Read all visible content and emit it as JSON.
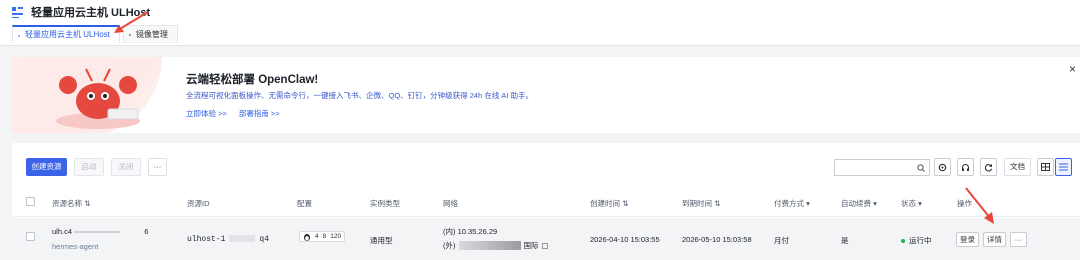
{
  "header": {
    "title": "轻量应用云主机 ULHost",
    "tabs": [
      {
        "label": "轻量应用云主机 ULHost",
        "active": true
      },
      {
        "label": "镜像管理",
        "active": false
      }
    ]
  },
  "banner": {
    "title": "云端轻松部署 OpenClaw!",
    "description": "全流程可视化面板操作、无需命令行，一键接入飞书、企微、QQ、钉钉，分钟级获得 24h 在线 AI 助手。",
    "link_try": "立即体验 >>",
    "link_guide": "部署指南 >>",
    "close": "×"
  },
  "toolbar": {
    "create": "创建资源",
    "start": "启动",
    "stop": "关闭",
    "more": "···",
    "search_placeholder": "",
    "docs": "文档"
  },
  "table": {
    "headers": {
      "name": "资源名称",
      "id": "资源ID",
      "config": "配置",
      "type": "实例类型",
      "network": "网络",
      "created": "创建时间",
      "expires": "到期时间",
      "billing": "付费方式",
      "renew": "自动续费",
      "status": "状态",
      "ops": "操作"
    },
    "rows": [
      {
        "name_prefix": "ulh.c4",
        "name_suffix": "6",
        "tag": "hermes-agent",
        "id_prefix": "ulhost-1",
        "id_suffix": "q4",
        "cpu": "4",
        "mem": "8",
        "disk": "120",
        "type": "通用型",
        "ip_internal": "(内) 10.35.26.29",
        "ip_external_prefix": "(外)",
        "ip_region": "国际",
        "created": "2026-04-10 15:03:55",
        "expires": "2026-05-10 15:03:58",
        "billing": "月付",
        "renew": "是",
        "status": "运行中",
        "status_color": "#22b35e",
        "op_login": "登录",
        "op_detail": "详情",
        "op_more": "···"
      }
    ]
  },
  "colors": {
    "primary": "#3b63e8",
    "annotation_arrow": "#e8483b"
  }
}
